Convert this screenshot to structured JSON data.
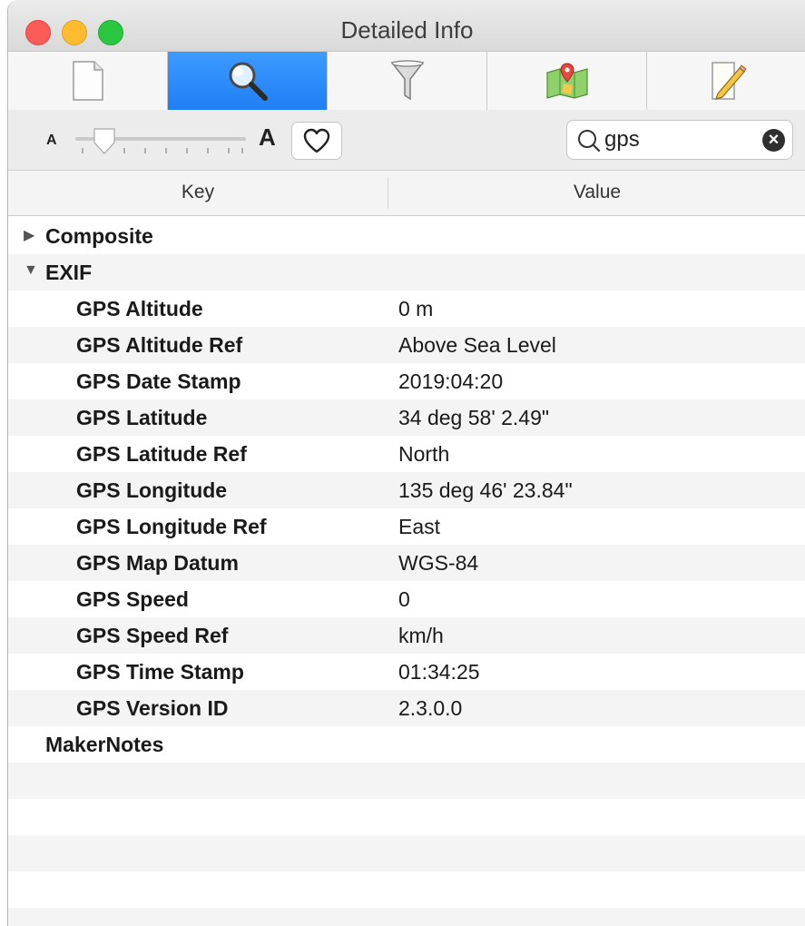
{
  "window": {
    "title": "Detailed Info"
  },
  "tabs": [
    {
      "icon": "document-icon",
      "active": false
    },
    {
      "icon": "magnifier-icon",
      "active": true
    },
    {
      "icon": "funnel-icon",
      "active": false
    },
    {
      "icon": "map-icon",
      "active": false
    },
    {
      "icon": "pencil-note-icon",
      "active": false
    }
  ],
  "toolbar": {
    "size_small_label": "A",
    "size_large_label": "A",
    "search_value": "gps"
  },
  "table": {
    "columns": [
      "Key",
      "Value"
    ],
    "groups": [
      {
        "label": "Composite",
        "expanded": false
      },
      {
        "label": "EXIF",
        "expanded": true
      }
    ],
    "rows": [
      {
        "key": "GPS Altitude",
        "value": "0 m"
      },
      {
        "key": "GPS Altitude Ref",
        "value": "Above Sea Level"
      },
      {
        "key": "GPS Date Stamp",
        "value": "2019:04:20"
      },
      {
        "key": "GPS Latitude",
        "value": "34 deg 58' 2.49\""
      },
      {
        "key": "GPS Latitude Ref",
        "value": "North"
      },
      {
        "key": "GPS Longitude",
        "value": "135 deg 46' 23.84\""
      },
      {
        "key": "GPS Longitude Ref",
        "value": "East"
      },
      {
        "key": "GPS Map Datum",
        "value": "WGS-84"
      },
      {
        "key": "GPS Speed",
        "value": "0"
      },
      {
        "key": "GPS Speed Ref",
        "value": "km/h"
      },
      {
        "key": "GPS Time Stamp",
        "value": "01:34:25"
      },
      {
        "key": "GPS Version ID",
        "value": "2.3.0.0"
      }
    ],
    "trailing_group": "MakerNotes"
  },
  "colors": {
    "accent": "#1f7ff5",
    "close": "#fd5b57",
    "minimize": "#febc2e",
    "maximize": "#29c840"
  }
}
